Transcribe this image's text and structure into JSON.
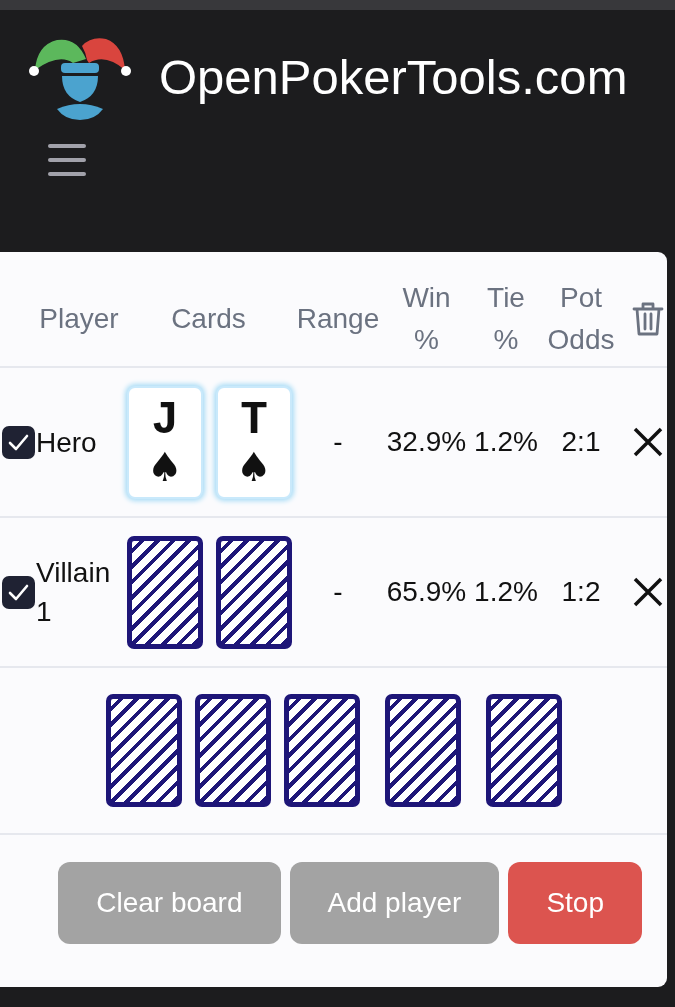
{
  "header": {
    "site_title": "OpenPokerTools.com"
  },
  "table": {
    "columns": [
      "Player",
      "Cards",
      "Range",
      "Win %",
      "Tie %",
      "Pot Odds"
    ],
    "players": [
      {
        "name": "Hero",
        "checked": true,
        "cards": [
          {
            "kind": "face_up",
            "rank": "J",
            "suit": "♠"
          },
          {
            "kind": "face_up",
            "rank": "T",
            "suit": "♠"
          }
        ],
        "range": "-",
        "win": "32.9%",
        "tie": "1.2%",
        "pot_odds": "2:1"
      },
      {
        "name": "Villain 1",
        "checked": true,
        "cards": [
          {
            "kind": "face_down"
          },
          {
            "kind": "face_down"
          }
        ],
        "range": "-",
        "win": "65.9%",
        "tie": "1.2%",
        "pot_odds": "1:2"
      }
    ],
    "board": [
      {
        "kind": "face_down"
      },
      {
        "kind": "face_down"
      },
      {
        "kind": "face_down"
      },
      {
        "kind": "face_down"
      },
      {
        "kind": "face_down"
      }
    ]
  },
  "buttons": [
    {
      "label": "Clear board",
      "kind": "secondary"
    },
    {
      "label": "Add player",
      "kind": "secondary"
    },
    {
      "label": "Stop",
      "kind": "danger"
    }
  ]
}
